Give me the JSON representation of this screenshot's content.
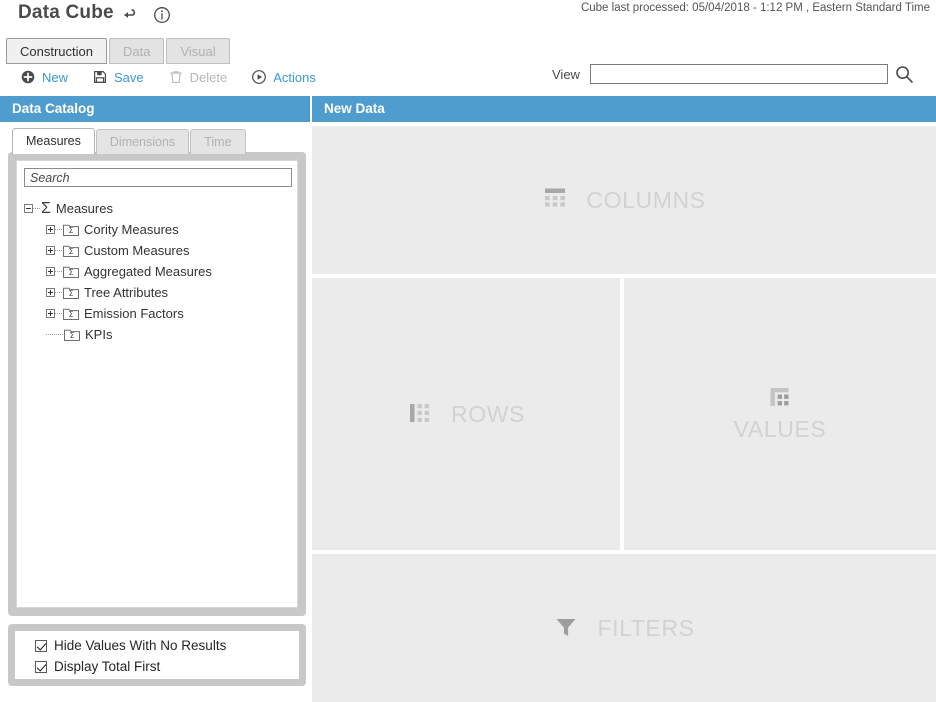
{
  "app": {
    "title": "Data Cube",
    "back_icon": "back-arrow-icon",
    "info_icon": "info-circle-icon",
    "status": "Cube last processed:  05/04/2018 - 1:12 PM , Eastern Standard Time"
  },
  "main_tabs": [
    {
      "label": "Construction",
      "active": true
    },
    {
      "label": "Data",
      "active": false
    },
    {
      "label": "Visual",
      "active": false
    }
  ],
  "toolbar": [
    {
      "label": "New",
      "icon": "plus-circle-icon",
      "disabled": false
    },
    {
      "label": "Save",
      "icon": "floppy-disk-icon",
      "disabled": false
    },
    {
      "label": "Delete",
      "icon": "trash-icon",
      "disabled": true
    },
    {
      "label": "Actions",
      "icon": "play-circle-icon",
      "disabled": false
    }
  ],
  "view": {
    "label": "View",
    "value": "",
    "placeholder": "",
    "search_icon": "magnifier-icon"
  },
  "catalog": {
    "header": "Data Catalog",
    "tabs": [
      {
        "label": "Measures",
        "active": true
      },
      {
        "label": "Dimensions",
        "active": false
      },
      {
        "label": "Time",
        "active": false
      }
    ],
    "search": {
      "value": "",
      "placeholder": "Search"
    },
    "tree": {
      "root": {
        "label": "Measures",
        "icon": "sigma-icon",
        "expanded": true
      },
      "children": [
        {
          "label": "Cority Measures",
          "icon": "sigma-folder-icon",
          "expandable": true
        },
        {
          "label": "Custom Measures",
          "icon": "sigma-folder-icon",
          "expandable": true
        },
        {
          "label": "Aggregated Measures",
          "icon": "sigma-folder-icon",
          "expandable": true
        },
        {
          "label": "Tree Attributes",
          "icon": "sigma-folder-icon",
          "expandable": true
        },
        {
          "label": "Emission Factors",
          "icon": "sigma-folder-icon",
          "expandable": true
        },
        {
          "label": "KPIs",
          "icon": "sigma-folder-icon",
          "expandable": false
        }
      ]
    },
    "options": [
      {
        "label": "Hide Values With No Results",
        "checked": true
      },
      {
        "label": "Display Total First",
        "checked": true
      }
    ]
  },
  "newdata": {
    "header": "New Data",
    "zones": [
      {
        "label": "COLUMNS",
        "icon": "columns-grid-icon"
      },
      {
        "label": "ROWS",
        "icon": "rows-grid-icon"
      },
      {
        "label": "VALUES",
        "icon": "values-grid-icon"
      },
      {
        "label": "FILTERS",
        "icon": "funnel-icon"
      }
    ]
  },
  "colors": {
    "accent": "#4f9dce",
    "link": "#3b9ad4",
    "zone_bg": "#ebebeb",
    "zone_text": "#d2d2d2",
    "panel_gray": "#c8c8c8"
  }
}
